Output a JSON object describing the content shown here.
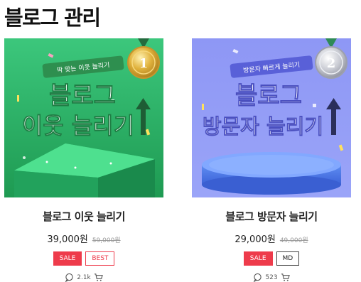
{
  "page": {
    "title": "블로그 관리"
  },
  "products": [
    {
      "name": "블로그 이웃 늘리기",
      "price": "39,000원",
      "original_price": "59,000원",
      "badges": [
        "SALE",
        "BEST"
      ],
      "review_count": "2.1k",
      "thumb": {
        "ribbon": "딱 맞는 이웃 늘리기",
        "medal": "1",
        "line1": "블로그",
        "line2": "이웃 늘리기",
        "medal_color": "gold",
        "bg_color": "#2fb86a"
      }
    },
    {
      "name": "블로그 방문자 늘리기",
      "price": "29,000원",
      "original_price": "49,000원",
      "badges": [
        "SALE",
        "MD"
      ],
      "review_count": "523",
      "thumb": {
        "ribbon": "방문자 빠르게 늘리기",
        "medal": "2",
        "line1": "블로그",
        "line2": "방문자 늘리기",
        "medal_color": "silver",
        "bg_color": "#7d86f0"
      }
    }
  ]
}
